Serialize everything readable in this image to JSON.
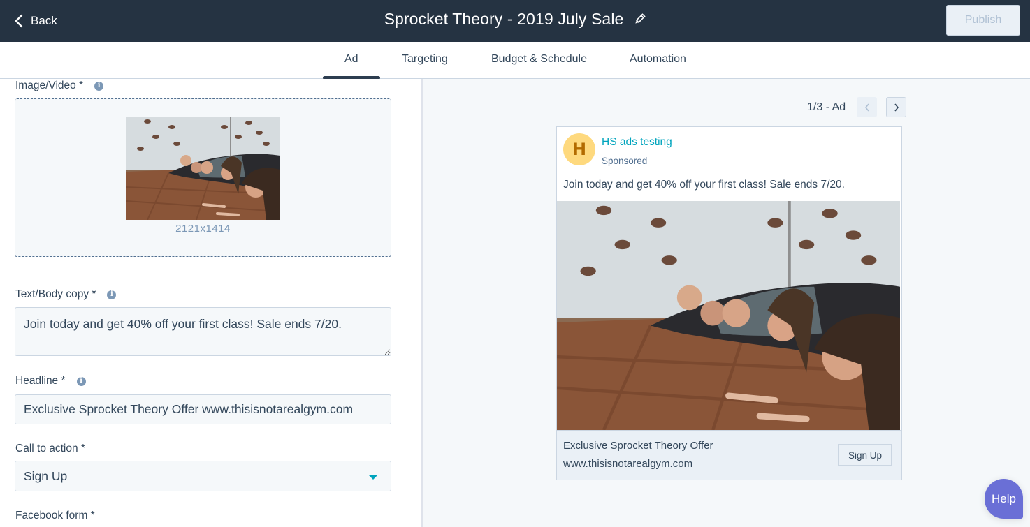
{
  "header": {
    "back_label": "Back",
    "title": "Sprocket Theory - 2019 July Sale",
    "edit_icon": "pencil-icon",
    "publish_label": "Publish"
  },
  "tabs": [
    {
      "label": "Ad",
      "active": true
    },
    {
      "label": "Targeting",
      "active": false
    },
    {
      "label": "Budget & Schedule",
      "active": false
    },
    {
      "label": "Automation",
      "active": false
    }
  ],
  "form": {
    "image_label": "Image/Video *",
    "image_dimensions": "2121x1414",
    "body_label": "Text/Body copy *",
    "body_value": "Join today and get 40% off your first class! Sale ends 7/20.",
    "headline_label": "Headline *",
    "headline_value": "Exclusive Sprocket Theory Offer www.thisisnotarealgym.com",
    "cta_label": "Call to action *",
    "cta_value": "Sign Up",
    "facebook_form_label": "Facebook form *",
    "info_icon": "info-icon"
  },
  "preview": {
    "pager_text": "1/3 - Ad",
    "avatar_letter": "H",
    "page_name": "HS ads testing",
    "sponsored": "Sponsored",
    "body": "Join today and get 40% off your first class! Sale ends 7/20.",
    "headline": "Exclusive Sprocket Theory Offer",
    "url": "www.thisisnotarealgym.com",
    "cta": "Sign Up"
  },
  "help_label": "Help",
  "colors": {
    "header_bg": "#253342",
    "accent_teal": "#00a4bd",
    "help_purple": "#6a6fd6",
    "avatar_bg": "#fed97e"
  }
}
